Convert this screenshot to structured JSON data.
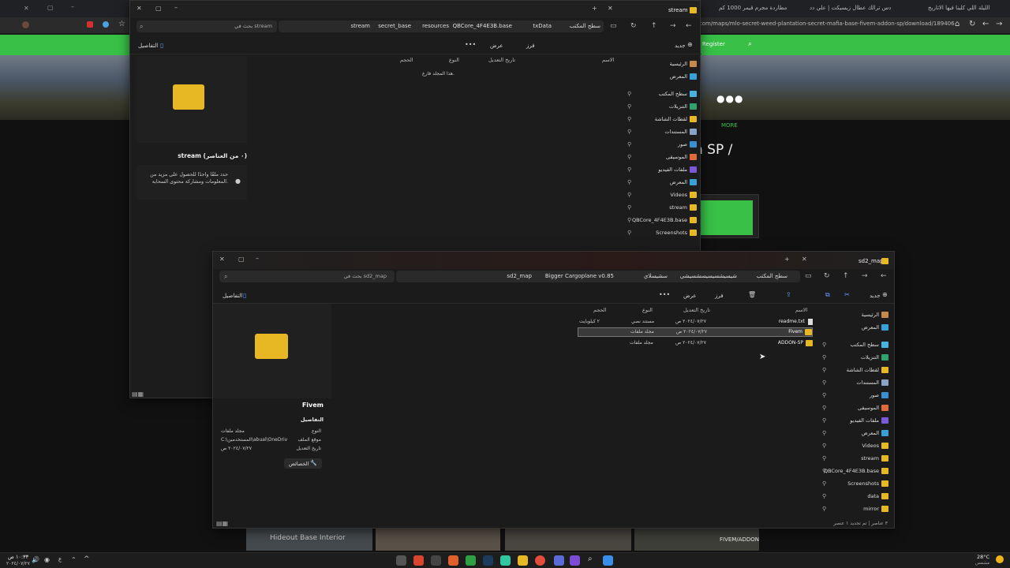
{
  "browser": {
    "tabs": [
      "الليلة اللي كلينا فيها الاتاريخ",
      "دس ترالك عطال زيسيكت | علي دد",
      "مطاردة مجرم قيمر 1000 كم",
      "stream"
    ],
    "url": "s.com/maps/mlo-secret-weed-plantation-secret-mafia-base-fivem-addon-sp/download/189406",
    "site_register": "Register",
    "more_label": "MORE",
    "title_fragment": "n SP /",
    "thumb_captions": [
      "Hideout Base Interior",
      "FIVEM/ADDON"
    ]
  },
  "explorer_back": {
    "tab_title": "stream",
    "breadcrumbs": [
      "سطح المكتب",
      "txData",
      "QBCore_4F4E3B.base",
      "resources",
      "secret_base",
      "stream"
    ],
    "search_placeholder": "بحث في stream",
    "toolbar": {
      "new": "جديد",
      "sort": "فرز",
      "view": "عرض",
      "details": "التفاصيل"
    },
    "columns": [
      "الاسم",
      "تاريخ التعديل",
      "النوع",
      "الحجم"
    ],
    "empty_message": "هذا المجلد فارغ.",
    "nav": [
      "الرئيسية",
      "المعرض",
      "سطح المكتب",
      "التنزيلات",
      "لقطات الشاشة",
      "المستندات",
      "صور",
      "الموسيقى",
      "ملفات الفيديو",
      "المعرض",
      "Videos",
      "stream",
      "QBCore_4F4E3B.base",
      "Screenshots"
    ],
    "details_title": "stream (٠ من العناصر)",
    "details_info": "حدد ملفًا واحدًا للحصول على مزيد من المعلومات ومشاركة محتوى السحابة."
  },
  "explorer_front": {
    "tab_title": "sd2_map",
    "breadcrumbs": [
      "سطح المكتب",
      "شيسيشسيسيسشسيشي",
      "سشيسلاي",
      "Bigger Cargoplane v0.85",
      "sd2_map"
    ],
    "search_placeholder": "بحث في sd2_map",
    "toolbar": {
      "new": "جديد",
      "sort": "فرز",
      "view": "عرض",
      "details": "التفاصيل"
    },
    "columns": [
      "الاسم",
      "تاريخ التعديل",
      "النوع",
      "الحجم"
    ],
    "rows": [
      {
        "name": "readme.txt",
        "date": "٢٠٢٤/٠٧/٢٧ ص",
        "type": "مستند نصي",
        "size": "٢ كيلوبايت",
        "icon": "text-file-icon"
      },
      {
        "name": "Fivem",
        "date": "٢٠٢٤/٠٧/٢٧ ص",
        "type": "مجلد ملفات",
        "size": "",
        "icon": "folder-icon"
      },
      {
        "name": "ADDON-SP",
        "date": "٢٠٢٤/٠٧/٢٧ ص",
        "type": "مجلد ملفات",
        "size": "",
        "icon": "folder-icon"
      }
    ],
    "nav": [
      "الرئيسية",
      "المعرض",
      "سطح المكتب",
      "التنزيلات",
      "لقطات الشاشة",
      "المستندات",
      "صور",
      "الموسيقى",
      "ملفات الفيديو",
      "المعرض",
      "Videos",
      "stream",
      "QBCore_4F4E3B.base",
      "Screenshots",
      "data",
      "mirror"
    ],
    "details_name": "Fivem",
    "details_heading": "التفاصيل",
    "details_labels": [
      "النوع",
      "موقع الملف",
      "تاريخ التعديل"
    ],
    "details_values": [
      "مجلد ملفات",
      "C:\\المستخدمين\\abual\\OneDrive...",
      "٢٠٢٤/٠٧/٢٧ ص"
    ],
    "properties_button": "الخصائص",
    "status": "٣ عناصر  |  تم تحديد ١ عنصر"
  },
  "taskbar": {
    "weather": "28°C",
    "weather_sub": "مشمس",
    "time": "١٠:٣٣ ص",
    "date": "٢٠٢٤/٠٧/٢٧",
    "lang": "ع"
  },
  "colors": {
    "accent_green": "#38c047",
    "folder": "#e8b824"
  }
}
